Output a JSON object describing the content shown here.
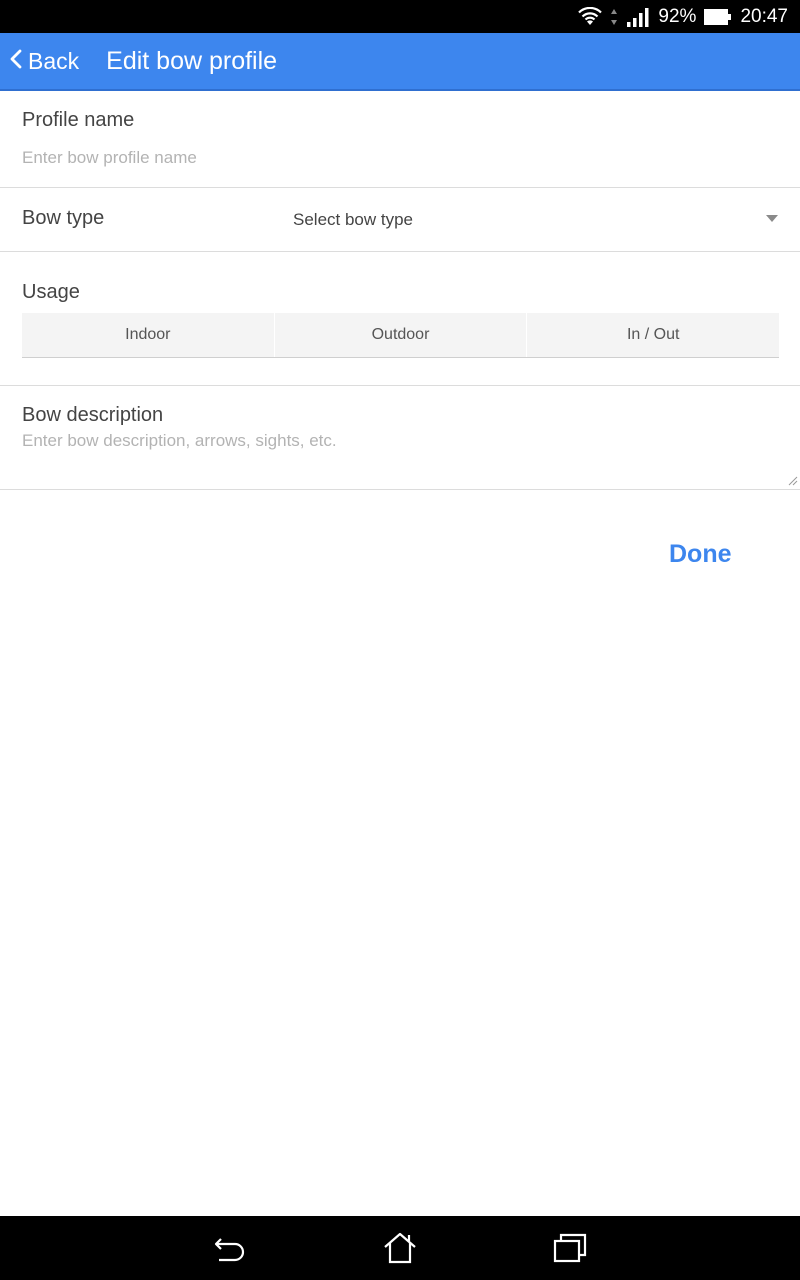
{
  "status_bar": {
    "battery_percent": "92%",
    "time": "20:47"
  },
  "header": {
    "back_label": "Back",
    "title": "Edit bow profile"
  },
  "form": {
    "profile_name": {
      "label": "Profile name",
      "value": "",
      "placeholder": "Enter bow profile name"
    },
    "bow_type": {
      "label": "Bow type",
      "selected": "Select bow type"
    },
    "usage": {
      "label": "Usage",
      "options": [
        "Indoor",
        "Outdoor",
        "In / Out"
      ]
    },
    "bow_description": {
      "label": "Bow description",
      "value": "",
      "placeholder": "Enter bow description, arrows, sights, etc."
    }
  },
  "actions": {
    "done_label": "Done"
  },
  "colors": {
    "accent": "#3d86ee",
    "status_bar": "#000000",
    "divider": "#dcdcdc",
    "placeholder": "#b3b3b3"
  },
  "icons": {
    "back": "chevron-left-icon",
    "dropdown": "chevron-down-icon",
    "nav_back": "nav-back-icon",
    "nav_home": "nav-home-icon",
    "nav_recents": "nav-recents-icon"
  }
}
